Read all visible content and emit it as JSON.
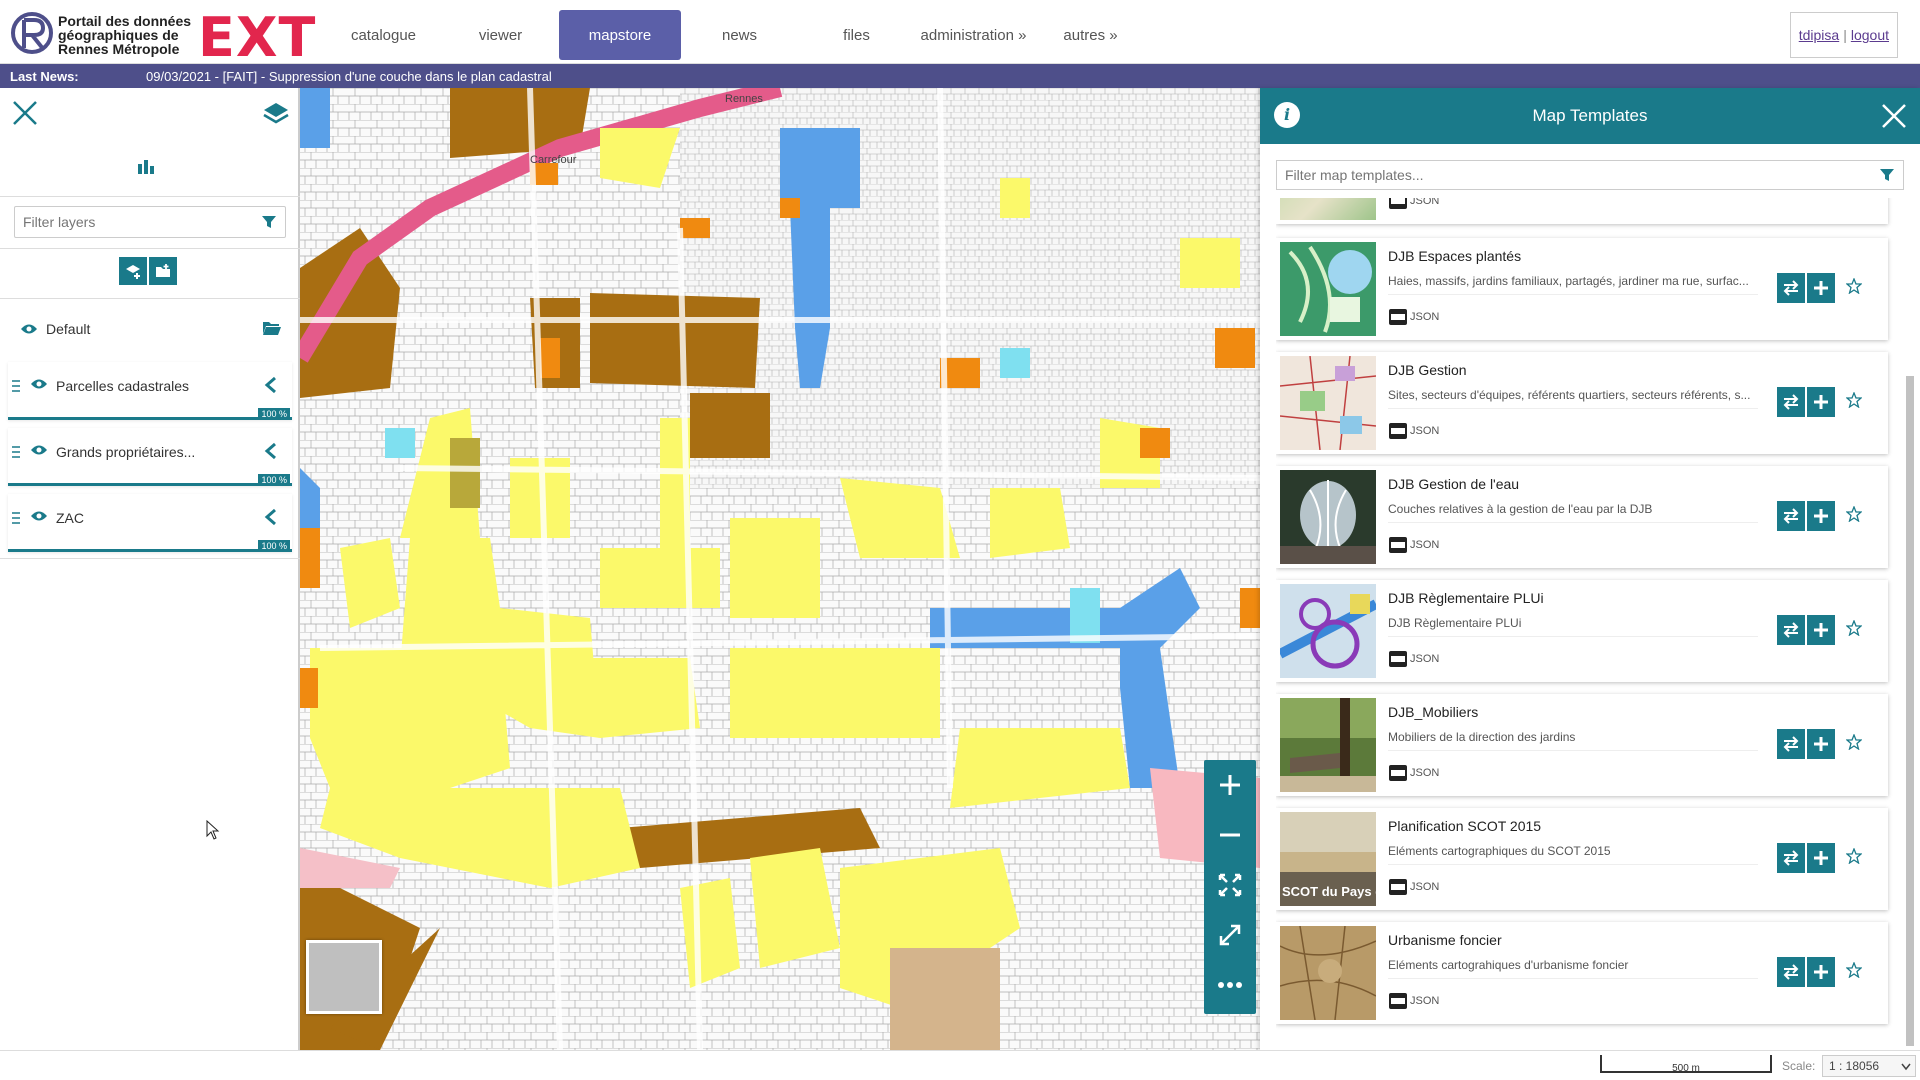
{
  "header": {
    "logo_text": "Portail des données géographiques de Rennes Métropole",
    "logo_ext": "EXT",
    "nav": [
      {
        "label": "catalogue"
      },
      {
        "label": "viewer"
      },
      {
        "label": "mapstore"
      },
      {
        "label": "news"
      },
      {
        "label": "files"
      },
      {
        "label": "administration »"
      },
      {
        "label": "autres »"
      }
    ],
    "active_nav": "mapstore",
    "user": "tdipisa",
    "separator": "|",
    "logout": "logout"
  },
  "news": {
    "label": "Last News:",
    "text": "09/03/2021 - [FAIT] - Suppression d'une couche dans le plan cadastral"
  },
  "toc": {
    "filter_placeholder": "Filter layers",
    "group_name": "Default",
    "layers": [
      {
        "name": "Parcelles cadastrales",
        "opacity": "100 %"
      },
      {
        "name": "Grands propriétaires...",
        "opacity": "100 %"
      },
      {
        "name": "ZAC",
        "opacity": "100 %"
      }
    ]
  },
  "templates_panel": {
    "title": "Map Templates",
    "filter_placeholder": "Filter map templates...",
    "items": [
      {
        "title": "",
        "description": "",
        "format": "JSON",
        "thumb": "green"
      },
      {
        "title": "DJB Espaces plantés",
        "description": "Haies, massifs, jardins familiaux, partagés, jardiner ma rue, surfac...",
        "format": "JSON",
        "thumb": "teal"
      },
      {
        "title": "DJB Gestion",
        "description": "Sites, secteurs d'équipes, référents quartiers, secteurs référents, s...",
        "format": "JSON",
        "thumb": "map"
      },
      {
        "title": "DJB Gestion de l'eau",
        "description": "Couches relatives à la gestion de l'eau par la DJB",
        "format": "JSON",
        "thumb": "water"
      },
      {
        "title": "DJB Règlementaire PLUi",
        "description": "DJB Règlementaire PLUi",
        "format": "JSON",
        "thumb": "plui"
      },
      {
        "title": "DJB_Mobiliers",
        "description": "Mobiliers de la direction des jardins",
        "format": "JSON",
        "thumb": "bench"
      },
      {
        "title": "Planification SCOT 2015",
        "description": "Eléments cartographiques du SCOT 2015",
        "format": "JSON",
        "thumb": "scot",
        "thumb_text": "SCOT du Pays de Rennes"
      },
      {
        "title": "Urbanisme foncier",
        "description": "Eléments cartograhiques d'urbanisme foncier",
        "format": "JSON",
        "thumb": "old"
      }
    ]
  },
  "footer": {
    "scalebar": "500 m",
    "scale_label": "Scale:",
    "scale_value": "1 : 18056"
  },
  "map": {
    "street_label_1": "Rennes",
    "street_label_2": "Carrefour"
  },
  "colors": {
    "accent": "#1a7a8a",
    "nav_active": "#5b5fa8",
    "news_bg": "#4e4f8a",
    "ext_red": "#e2264d"
  }
}
